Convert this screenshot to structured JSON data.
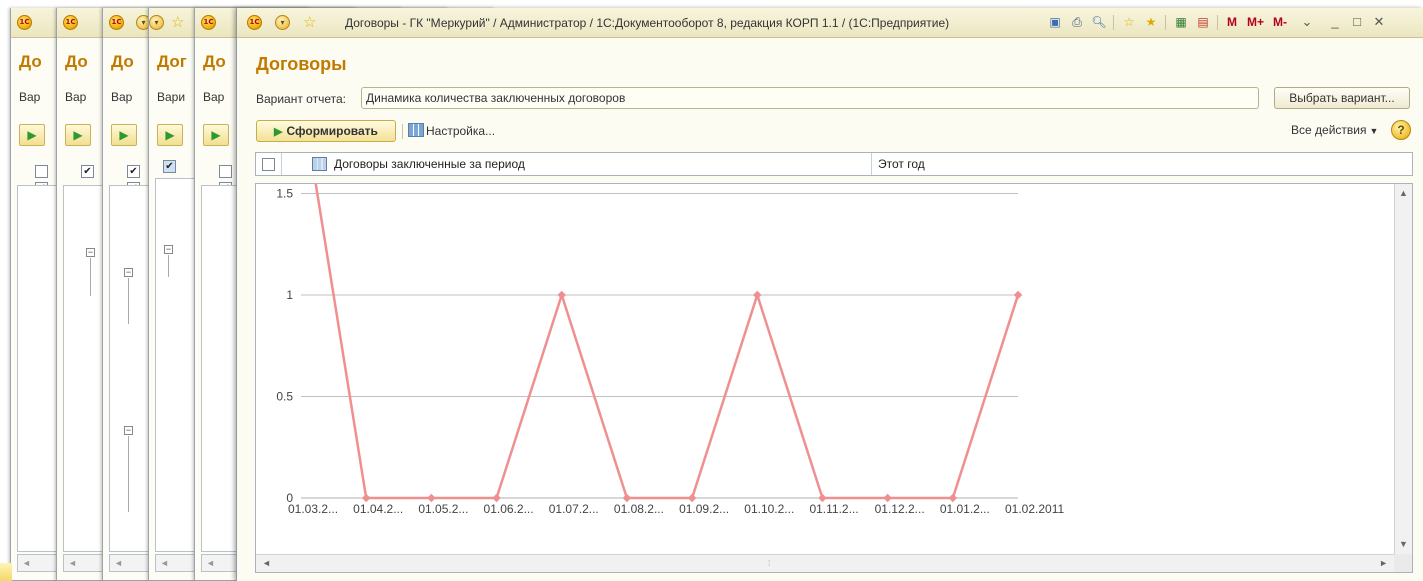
{
  "window": {
    "title": "Договоры - ГК \"Меркурий\" / Администратор / 1С:Документооборот 8, редакция КОРП 1.1 / (1С:Предприятие)",
    "logo_text": "1C",
    "toolbar": {
      "mem_m": "M",
      "mem_mplus": "M+",
      "mem_mminus": "M-"
    }
  },
  "background_windows": [
    {
      "title": "До",
      "variant": "Вар"
    },
    {
      "title": "До",
      "variant": "Вар"
    },
    {
      "title": "До",
      "variant": "Вар"
    },
    {
      "title": "Дог",
      "variant": "Вари"
    },
    {
      "title": "До",
      "variant": "Вар"
    }
  ],
  "form": {
    "title": "Договоры",
    "variant_label": "Вариант отчета:",
    "variant_value": "Динамика количества заключенных договоров",
    "choose_variant_button": "Выбрать вариант...",
    "run_button": "Сформировать",
    "settings_button": "Настройка...",
    "all_actions": "Все действия",
    "help": "?"
  },
  "settings_grid": {
    "row": {
      "name": "Договоры заключенные за период",
      "value": "Этот год",
      "checked": false
    }
  },
  "chart_data": {
    "type": "line",
    "series": [
      {
        "values": [
          2,
          0,
          0,
          0,
          1,
          0,
          0,
          1,
          0,
          0,
          0,
          1
        ],
        "color": "#ef8f8f"
      }
    ],
    "categories": [
      "01.03.2...",
      "01.04.2...",
      "01.05.2...",
      "01.06.2...",
      "01.07.2...",
      "01.08.2...",
      "01.09.2...",
      "01.10.2...",
      "01.11.2...",
      "01.12.2...",
      "01.01.2...",
      "01.02.2011"
    ],
    "y_ticks": [
      "0",
      "0.5",
      "1",
      "1.5"
    ],
    "ylim": [
      0,
      1.5
    ],
    "grid": true
  },
  "colors": {
    "accent_title": "#c07a00",
    "series_line": "#ef8f8f",
    "gridline": "#c0c0c0"
  }
}
